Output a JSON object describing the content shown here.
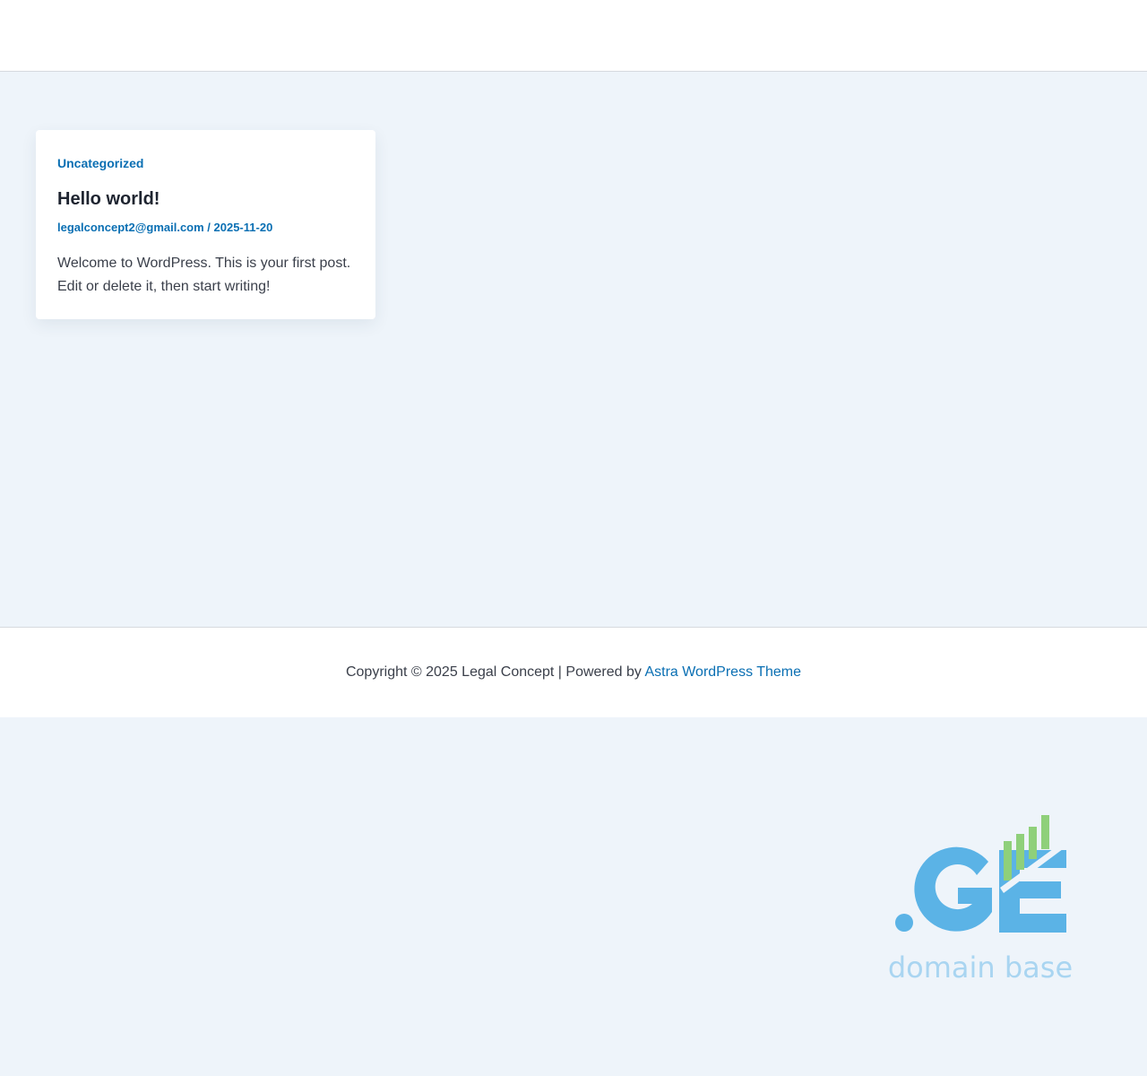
{
  "post": {
    "category": "Uncategorized",
    "title": "Hello world!",
    "author": "legalconcept2@gmail.com",
    "meta_separator": " / ",
    "date": "2025-11-20",
    "excerpt": "Welcome to WordPress. This is your first post. Edit or delete it, then start writing!"
  },
  "footer": {
    "copyright": "Copyright © 2025 Legal Concept | Powered by ",
    "theme_link": "Astra WordPress Theme"
  },
  "logo": {
    "text": "domain base",
    "mark": ".GE",
    "colors": {
      "blue": "#5bb3e6",
      "green": "#8fd07a",
      "light_blue": "#a9d5f1"
    }
  },
  "colors": {
    "accent": "#0a6fb3",
    "page_background": "#eef4fa"
  }
}
